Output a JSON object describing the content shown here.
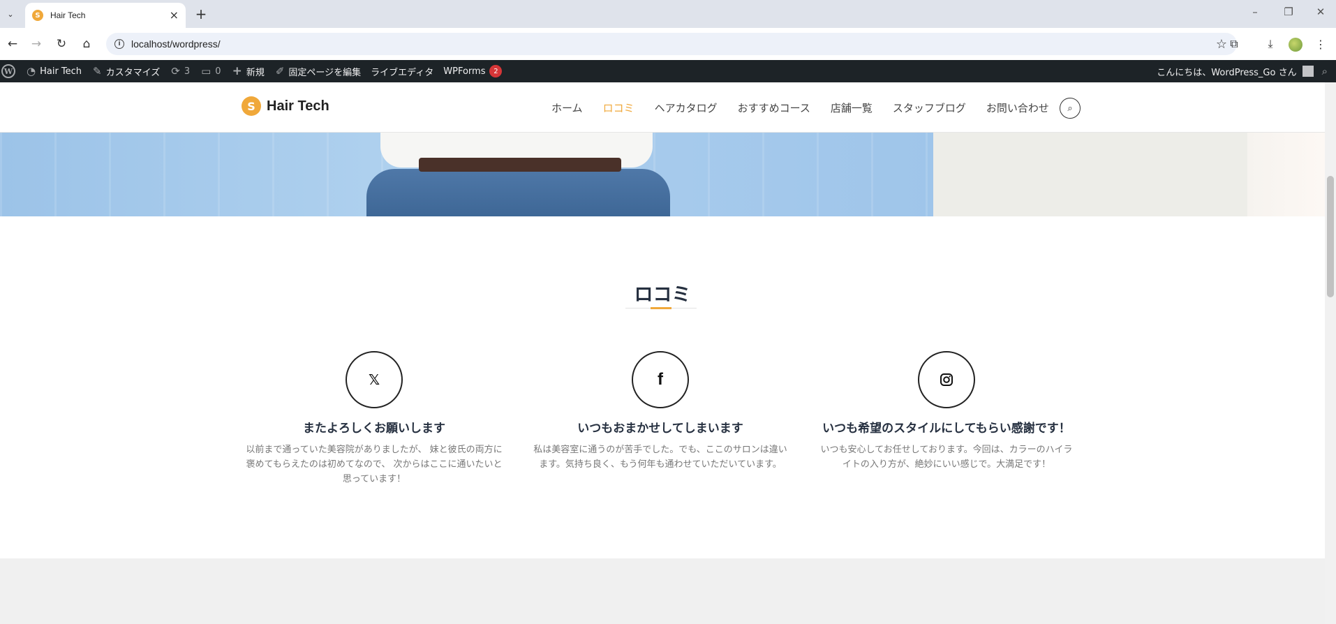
{
  "browser": {
    "tab_title": "Hair Tech",
    "url": "localhost/wordpress/"
  },
  "adminbar": {
    "site_name": "Hair Tech",
    "customize": "カスタマイズ",
    "updates_count": "3",
    "comments_count": "0",
    "new": "新規",
    "edit_page": "固定ページを編集",
    "live_editor": "ライブエディタ",
    "wpforms": "WPForms",
    "wpforms_badge": "2",
    "greeting": "こんにちは、WordPress_Go さん"
  },
  "site": {
    "logo_text": "Hair Tech",
    "nav": [
      {
        "label": "ホーム"
      },
      {
        "label": "ロコミ"
      },
      {
        "label": "ヘアカタログ"
      },
      {
        "label": "おすすめコース"
      },
      {
        "label": "店舗一覧"
      },
      {
        "label": "スタッフブログ"
      },
      {
        "label": "お問い合わせ"
      }
    ],
    "active_nav": "ロコミ",
    "accent_color": "#f0a83a"
  },
  "reviews": {
    "title": "ロコミ",
    "items": [
      {
        "icon": "twitter-icon",
        "title": "またよろしくお願いします",
        "text": "以前まで通っていた美容院がありましたが、 妹と彼氏の両方に褒めてもらえたのは初めてなので、 次からはここに通いたいと思っています！"
      },
      {
        "icon": "facebook-icon",
        "title": "いつもおまかせしてしまいます",
        "text": "私は美容室に通うのが苦手でした。でも、ここのサロンは違います。気持ち良く、もう何年も通わせていただいています。"
      },
      {
        "icon": "instagram-icon",
        "title": "いつも希望のスタイルにしてもらい感謝です！",
        "text": "いつも安心してお任せしております。今回は、カラーのハイライトの入り方が、絶妙にいい感じで。大満足です！"
      }
    ]
  }
}
